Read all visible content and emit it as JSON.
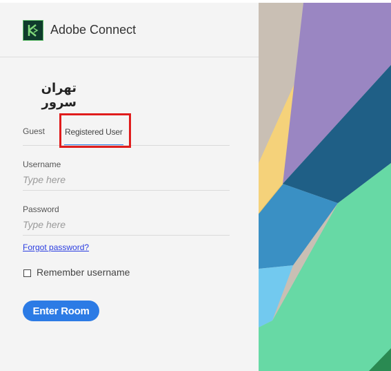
{
  "header": {
    "title": "Adobe Connect",
    "logo_icon": "adobe-connect-logo-icon"
  },
  "room": {
    "name": "تهران سرور"
  },
  "tabs": [
    {
      "label": "Guest",
      "selected": false
    },
    {
      "label": "Registered User",
      "selected": true
    }
  ],
  "username": {
    "label": "Username",
    "placeholder": "Type here",
    "value": ""
  },
  "password": {
    "label": "Password",
    "placeholder": "Type here",
    "value": ""
  },
  "forgot_password": "Forgot password?",
  "remember": {
    "label": "Remember username",
    "checked": false
  },
  "enter_button": "Enter Room",
  "colors": {
    "accent": "#2c7be5",
    "highlight": "#e01c1c",
    "panel_bg": "#f4f4f4"
  }
}
